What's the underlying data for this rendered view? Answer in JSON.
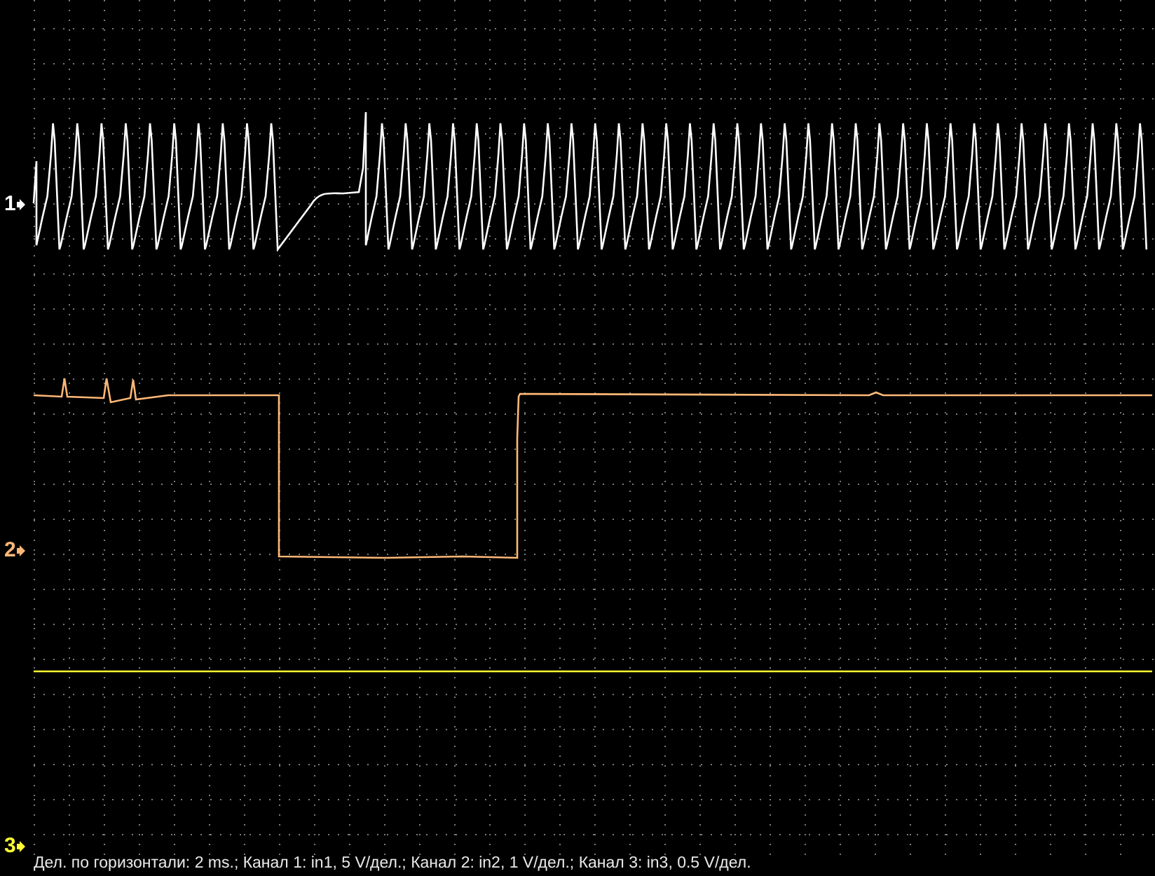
{
  "channels": [
    {
      "marker": "1",
      "color": "#ffffff",
      "kind": "oscillation"
    },
    {
      "marker": "2",
      "color": "#ffb877",
      "kind": "pulse"
    },
    {
      "marker": "3",
      "color": "#ffff33",
      "kind": "flat"
    }
  ],
  "status_bar": "Дел. по горизонтали: 2 ms.; Канал 1: in1, 5 V/дел.; Канал 2: in2, 1 V/дел.; Канал 3: in3, 0.5 V/дел."
}
